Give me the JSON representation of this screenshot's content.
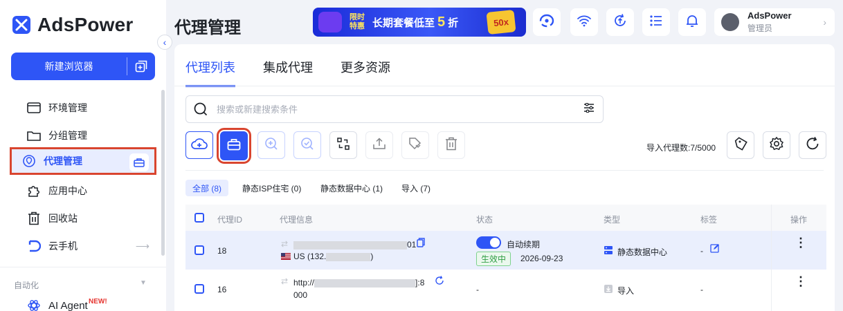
{
  "app": {
    "name": "AdsPower"
  },
  "sidebar": {
    "new_browser_label": "新建浏览器",
    "items": [
      {
        "label": "环境管理",
        "icon": "window-icon"
      },
      {
        "label": "分组管理",
        "icon": "folder-icon"
      },
      {
        "label": "代理管理",
        "icon": "globe-pin-icon",
        "active": true
      },
      {
        "label": "应用中心",
        "icon": "puzzle-icon"
      },
      {
        "label": "回收站",
        "icon": "trash-icon"
      },
      {
        "label": "云手机",
        "icon": "cloud-phone-icon"
      }
    ],
    "section_label": "自动化",
    "ai_agent_label": "AI Agent",
    "new_badge": "NEW!"
  },
  "header": {
    "page_title": "代理管理",
    "banner": {
      "tag_line1": "限时",
      "tag_line2": "特惠",
      "text": "长期套餐低至",
      "number": "5",
      "unit": "折",
      "box": "50x"
    },
    "user": {
      "name": "AdsPower",
      "role": "管理员"
    }
  },
  "tabs": [
    {
      "label": "代理列表",
      "active": true
    },
    {
      "label": "集成代理"
    },
    {
      "label": "更多资源"
    }
  ],
  "search": {
    "placeholder": "搜索或新建搜索条件"
  },
  "import_count": "导入代理数:7/5000",
  "filters": [
    {
      "label": "全部 (8)",
      "active": true
    },
    {
      "label": "静态ISP住宅 (0)"
    },
    {
      "label": "静态数据中心 (1)"
    },
    {
      "label": "导入 (7)"
    }
  ],
  "table": {
    "columns": [
      "代理ID",
      "代理信息",
      "状态",
      "类型",
      "标签",
      "操作"
    ],
    "rows": [
      {
        "id": "18",
        "info_line1_suffix": "01",
        "info_line2": "US (132.",
        "info_line2_end": ")",
        "auto_renew": "自动续期",
        "status": "生效中",
        "expiry": "2026-09-23",
        "type": "静态数据中心",
        "tag": "-"
      },
      {
        "id": "16",
        "info_line1": "http://",
        "info_line1_end": "]:8",
        "info_line1b": "000",
        "status": "-",
        "type": "导入",
        "tag": "-"
      }
    ]
  },
  "colors": {
    "accent": "#2e55f6",
    "highlight_border": "#d9452f",
    "success": "#2f9e44"
  }
}
